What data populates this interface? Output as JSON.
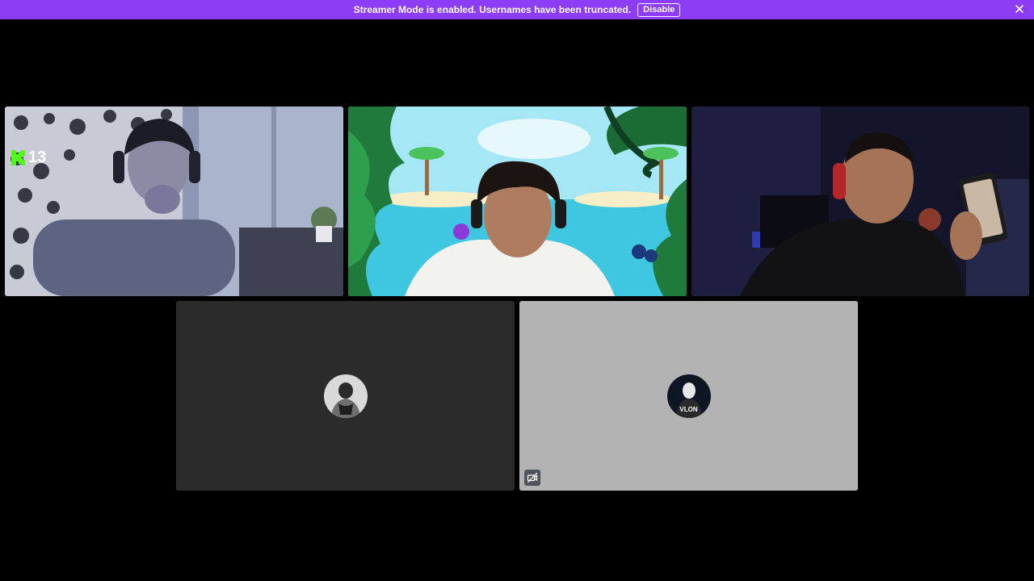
{
  "banner": {
    "message": "Streamer Mode is enabled. Usernames have been truncated.",
    "disable_label": "Disable",
    "background": "#8c3df5"
  },
  "tiles": [
    {
      "id": "tile1",
      "type": "video",
      "badge": {
        "icon": "kick-logo-icon",
        "value": "13",
        "color": "#53fc18"
      }
    },
    {
      "id": "tile2",
      "type": "video",
      "scene": "jungle-beach"
    },
    {
      "id": "tile3",
      "type": "video",
      "speaking": true,
      "speaking_color": "#3fa35c"
    },
    {
      "id": "tile4",
      "type": "avatar",
      "background": "#2b2b2b"
    },
    {
      "id": "tile5",
      "type": "avatar",
      "background": "#b3b3b3",
      "avatar_text": "VLON",
      "camera_off_icon": "camera-off-icon"
    }
  ]
}
